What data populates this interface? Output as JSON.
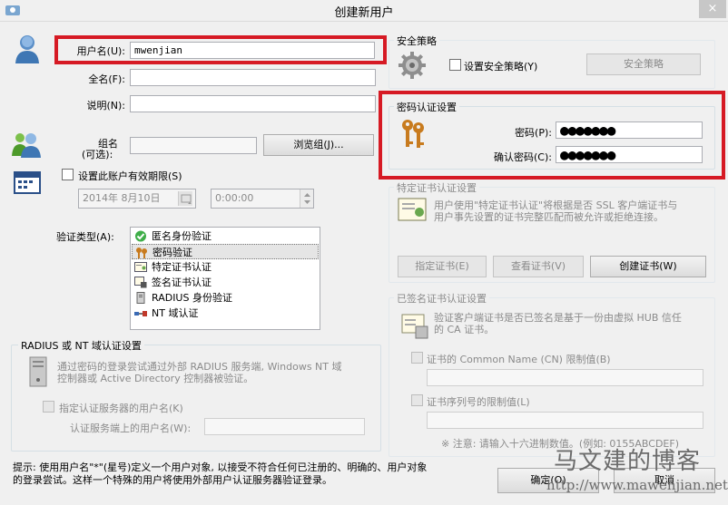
{
  "window": {
    "title": "创建新用户",
    "close_label": "×"
  },
  "user": {
    "username_label": "用户名(U):",
    "username_value": "mwenjian",
    "fullname_label": "全名(F):",
    "description_label": "说明(N):",
    "group_label_line1": "组名",
    "group_label_line2": "(可选):",
    "browse_group_button": "浏览组(J)...",
    "expiry_checkbox_label": "设置此账户有效期限(S)",
    "expiry_date": "2014年 8月10日",
    "expiry_time": "0:00:00"
  },
  "auth": {
    "type_label": "验证类型(A):",
    "items": [
      {
        "label": "匿名身份验证",
        "icon": "green-check-icon"
      },
      {
        "label": "密码验证",
        "icon": "keys-icon"
      },
      {
        "label": "特定证书认证",
        "icon": "certificate-icon"
      },
      {
        "label": "签名证书认证",
        "icon": "signed-certificate-icon"
      },
      {
        "label": "RADIUS 身份验证",
        "icon": "server-icon"
      },
      {
        "label": "NT 域认证",
        "icon": "network-cable-icon"
      }
    ],
    "selected_index": 1
  },
  "radius": {
    "title": "RADIUS 或 NT 域认证设置",
    "desc_line1": "通过密码的登录尝试通过外部 RADIUS 服务端, Windows NT 域",
    "desc_line2": "控制器或 Active Directory 控制器被验证。",
    "specify_checkbox_label": "指定认证服务器的用户名(K)",
    "server_username_label": "认证服务端上的用户名(W):"
  },
  "hint": {
    "line1": "提示: 使用用户名\"*\"(星号)定义一个用户对象, 以接受不符合任何已注册的、明确的、用户对象",
    "line2": "的登录尝试。这样一个特殊的用户将使用外部用户认证服务器验证登录。"
  },
  "policy": {
    "title": "安全策略",
    "checkbox_label": "设置安全策略(Y)",
    "button": "安全策略"
  },
  "password": {
    "title": "密码认证设置",
    "password_label": "密码(P):",
    "confirm_label": "确认密码(C):",
    "password_mask": "●●●●●●●",
    "confirm_mask": "●●●●●●●"
  },
  "specific_cert": {
    "title": "特定证书认证设置",
    "desc_line1": "用户使用\"特定证书认证\"将根据是否 SSL 客户端证书与",
    "desc_line2": "用户事先设置的证书完整匹配而被允许或拒绝连接。",
    "specify_button": "指定证书(E)",
    "view_button": "查看证书(V)",
    "create_button": "创建证书(W)"
  },
  "signed_cert": {
    "title": "已签名证书认证设置",
    "desc_line1": "验证客户端证书是否已签名是基于一份由虚拟 HUB 信任",
    "desc_line2": "的 CA 证书。",
    "cn_checkbox_label": "证书的 Common Name (CN) 限制值(B)",
    "serial_checkbox_label": "证书序列号的限制值(L)",
    "note": "※ 注意: 请输入十六进制数值。(例如: 0155ABCDEF)"
  },
  "footer": {
    "ok_button": "确定(O)",
    "cancel_button": "取消"
  },
  "watermark": {
    "text": "马文建的博客",
    "url": "http://www.mawenjian.net/"
  },
  "colors": {
    "highlight_border": "#d61a24",
    "window_bg": "#f0f0f0"
  }
}
